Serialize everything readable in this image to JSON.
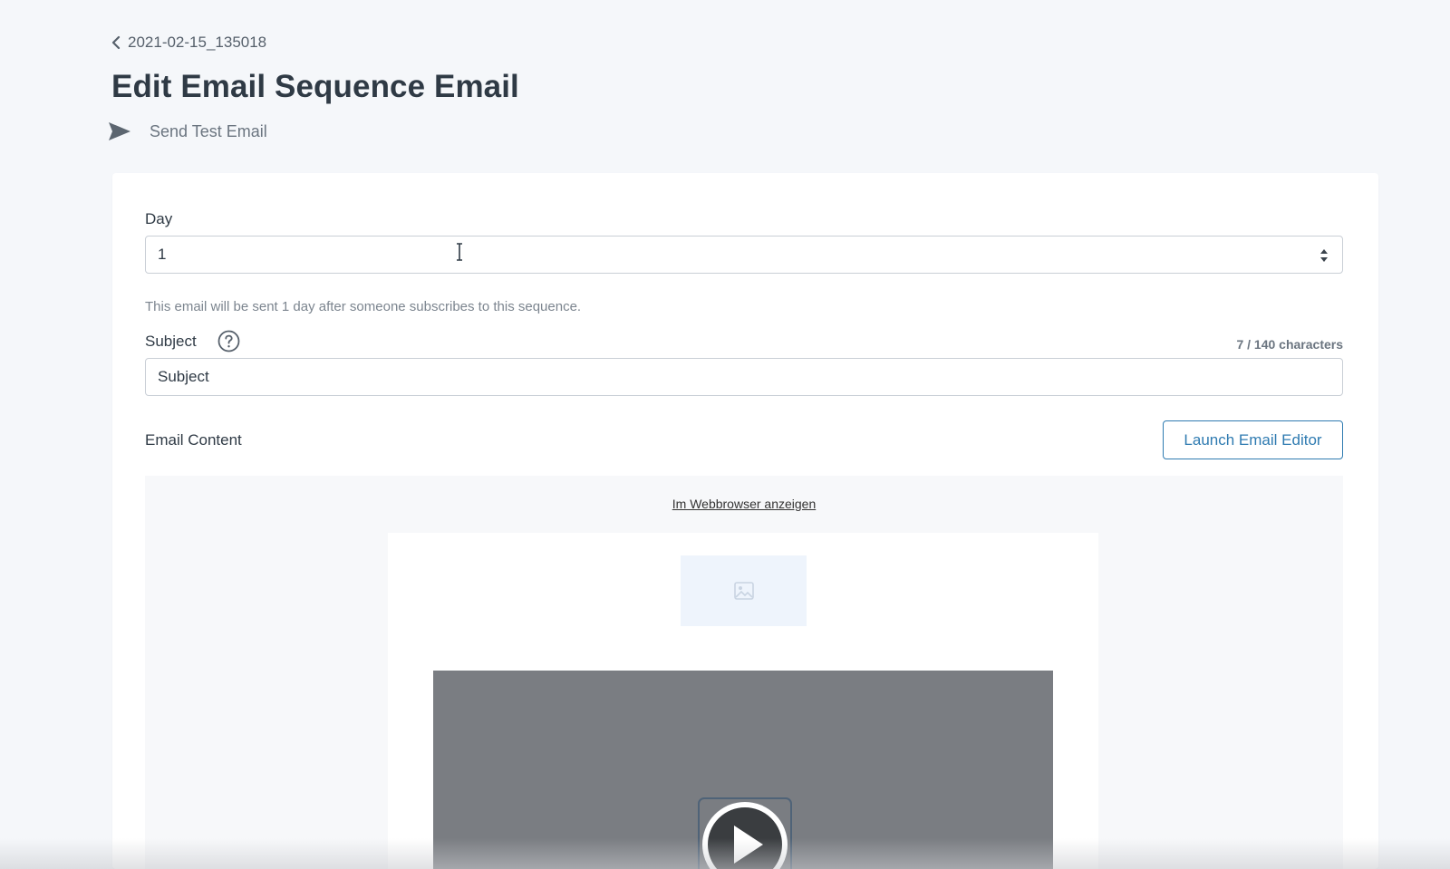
{
  "breadcrumb": {
    "label": "2021-02-15_135018",
    "icon": "chevron-left-icon"
  },
  "header": {
    "title": "Edit Email Sequence Email",
    "send_test_label": "Send Test Email",
    "send_test_icon": "paper-plane-icon"
  },
  "form": {
    "day": {
      "label": "Day",
      "value": "1",
      "helper": "This email will be sent 1 day after someone subscribes to this sequence."
    },
    "subject": {
      "label": "Subject",
      "help_icon": "question-circle-icon",
      "char_count": "7 / 140 characters",
      "value": "Subject"
    },
    "email_content": {
      "label": "Email Content",
      "launch_button": "Launch Email Editor"
    }
  },
  "preview": {
    "webbrowser_link": "Im Webbrowser anzeigen",
    "image_icon": "image-placeholder-icon",
    "video_icon": "play-icon"
  },
  "colors": {
    "accent": "#2f7bb1",
    "background": "#f5f7fa",
    "title": "#2f3a45"
  }
}
